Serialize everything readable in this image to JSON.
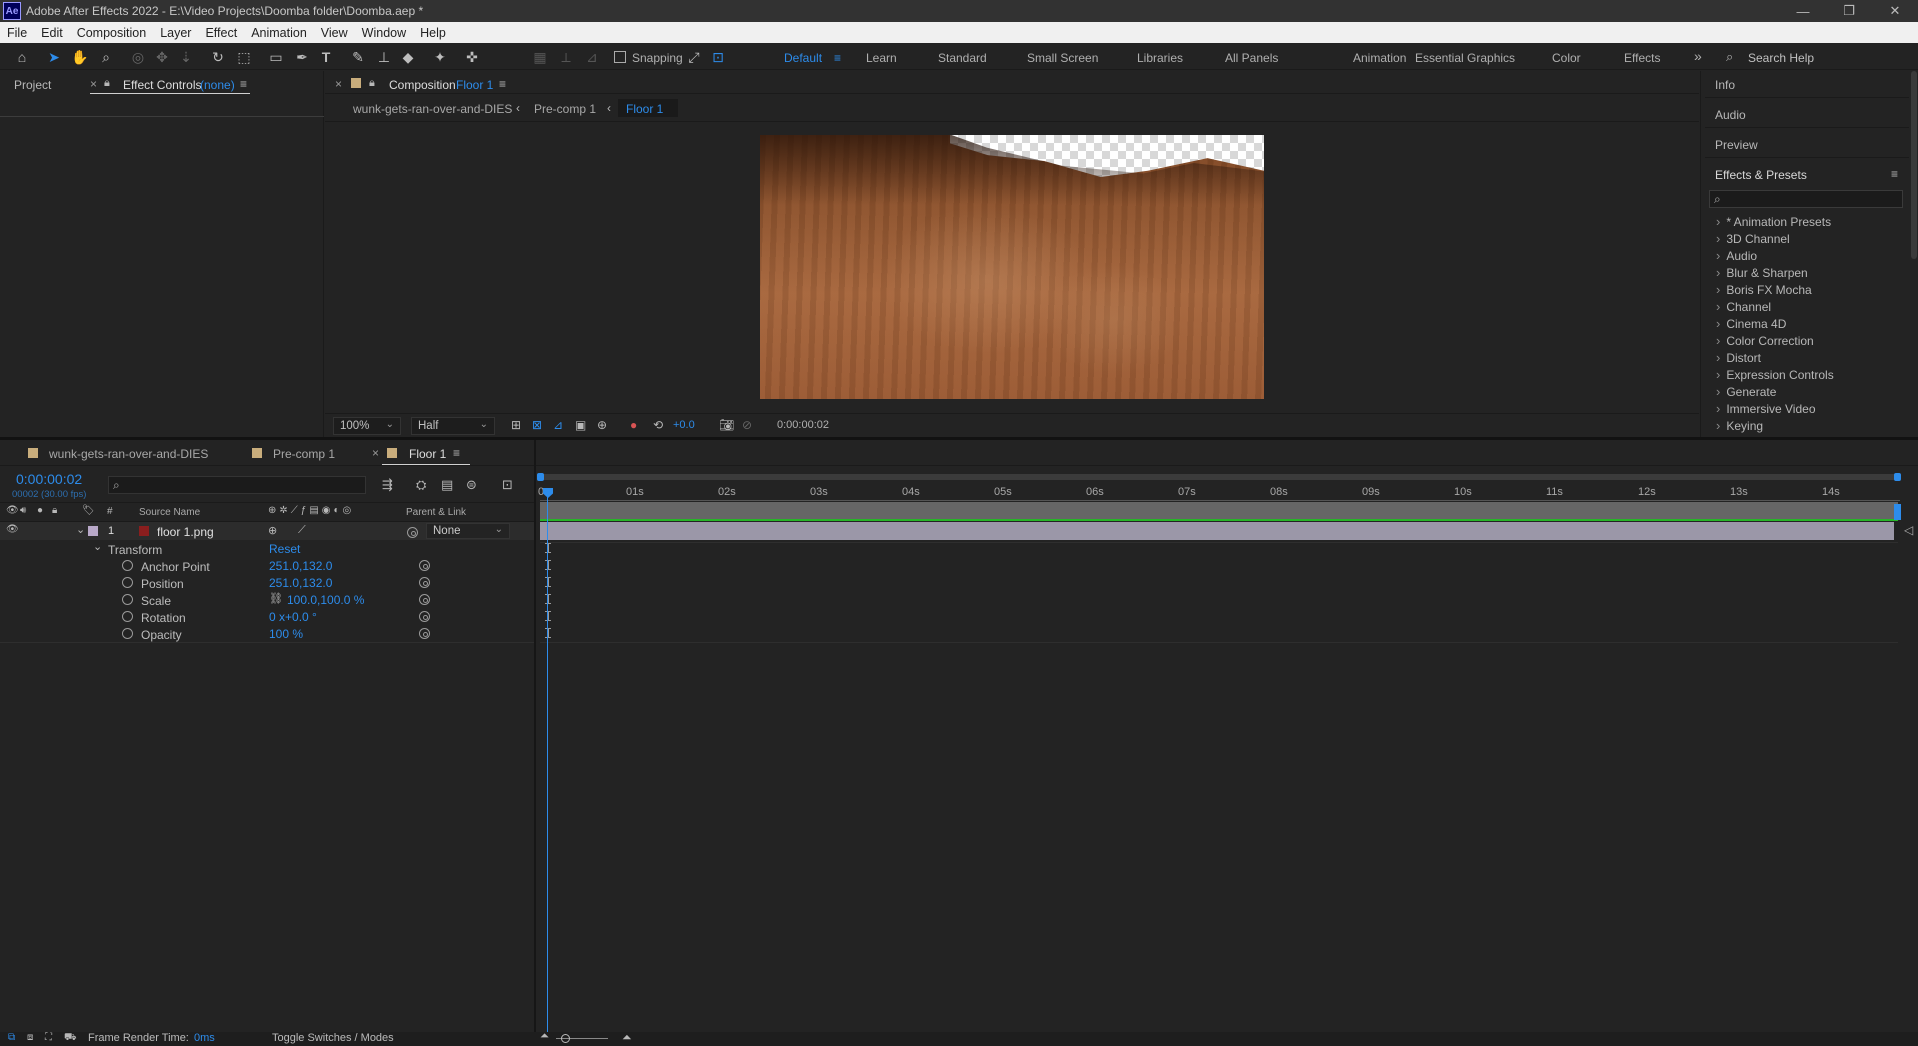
{
  "app": {
    "title": "Adobe After Effects 2022 - E:\\Video Projects\\Doomba folder\\Doomba.aep *",
    "logo_text": "Ae"
  },
  "window_controls": {
    "minimize": "—",
    "restore": "❐",
    "close": "✕"
  },
  "menu": [
    "File",
    "Edit",
    "Composition",
    "Layer",
    "Effect",
    "Animation",
    "View",
    "Window",
    "Help"
  ],
  "toolbar": {
    "snapping_label": "Snapping",
    "workspaces": [
      "Default",
      "Learn",
      "Standard",
      "Small Screen",
      "Libraries",
      "All Panels",
      "Animation",
      "Essential Graphics",
      "Color",
      "Effects"
    ],
    "active_workspace": "Default",
    "search_placeholder": "Search Help"
  },
  "left_panel": {
    "tabs": [
      "Project",
      "Effect Controls"
    ],
    "effect_controls_suffix": "(none)"
  },
  "composition_panel": {
    "tab_label": "Composition",
    "tab_comp": "Floor 1",
    "breadcrumbs": [
      "wunk-gets-ran-over-and-DIES",
      "Pre-comp 1",
      "Floor 1"
    ],
    "zoom": "100%",
    "resolution": "Half",
    "exposure": "+0.0",
    "timecode": "0:00:00:02"
  },
  "right_panel": {
    "sections": [
      "Info",
      "Audio",
      "Preview",
      "Effects & Presets"
    ],
    "search_placeholder": "",
    "effects": [
      "* Animation Presets",
      "3D Channel",
      "Audio",
      "Blur & Sharpen",
      "Boris FX Mocha",
      "Channel",
      "Cinema 4D",
      "Color Correction",
      "Distort",
      "Expression Controls",
      "Generate",
      "Immersive Video",
      "Keying"
    ]
  },
  "timeline": {
    "tabs": [
      "wunk-gets-ran-over-and-DIES",
      "Pre-comp 1",
      "Floor 1"
    ],
    "current_time": "0:00:00:02",
    "frame_info": "00002 (30.00 fps)",
    "columns": {
      "source_name": "Source Name",
      "parent": "Parent & Link",
      "num": "#"
    },
    "layer": {
      "index": "1",
      "name": "floor 1.png",
      "parent": "None"
    },
    "transform_label": "Transform",
    "reset_label": "Reset",
    "properties": [
      {
        "name": "Anchor Point",
        "value": "251.0,132.0"
      },
      {
        "name": "Position",
        "value": "251.0,132.0"
      },
      {
        "name": "Scale",
        "value": "100.0,100.0 %"
      },
      {
        "name": "Rotation",
        "value": "0 x+0.0 °"
      },
      {
        "name": "Opacity",
        "value": "100 %"
      }
    ],
    "ruler": [
      "0s",
      "01s",
      "02s",
      "03s",
      "04s",
      "05s",
      "06s",
      "07s",
      "08s",
      "09s",
      "10s",
      "11s",
      "12s",
      "13s",
      "14s"
    ],
    "footer": {
      "render_label": "Frame Render Time:",
      "render_value": "0ms",
      "toggle_label": "Toggle Switches / Modes"
    }
  },
  "colors": {
    "accent": "#2d8ceb",
    "panel_bg": "#232323",
    "layer_bar": "#9b97a8",
    "layer_label": "#b9a9c9"
  }
}
